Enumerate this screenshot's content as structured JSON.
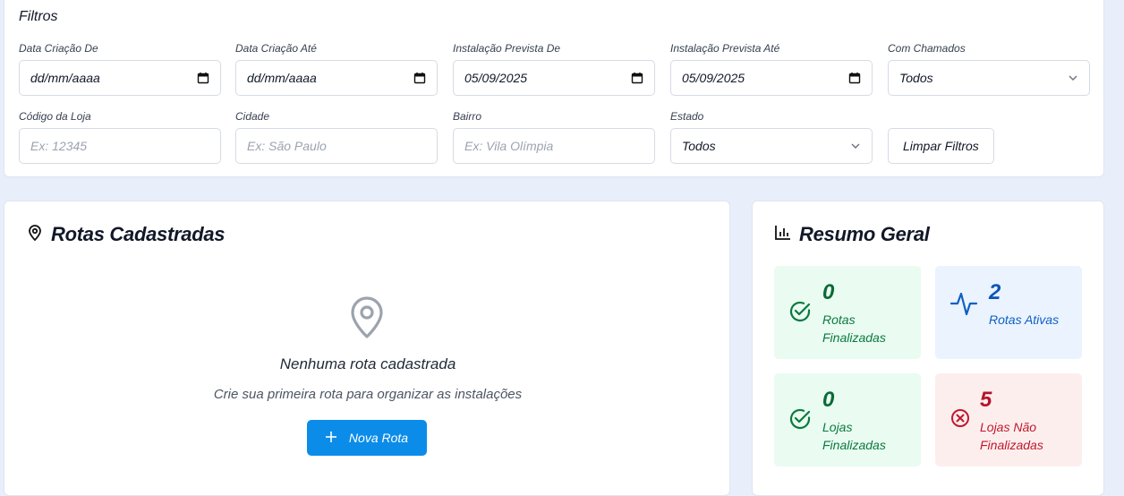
{
  "filters": {
    "title": "Filtros",
    "fields": [
      {
        "label": "Data Criação De",
        "value": "dd/mm/aaaa",
        "icon": "calendar-icon"
      },
      {
        "label": "Data Criação Até",
        "value": "dd/mm/aaaa",
        "icon": "calendar-icon"
      },
      {
        "label": "Instalação Prevista De",
        "value": "05/09/2025",
        "icon": "calendar-icon"
      },
      {
        "label": "Instalação Prevista Até",
        "value": "05/09/2025",
        "icon": "calendar-icon"
      },
      {
        "label": "Com Chamados",
        "value": "Todos",
        "icon": "chevron-down-icon"
      },
      {
        "label": "Código da Loja",
        "placeholder": "Ex: 12345"
      },
      {
        "label": "Cidade",
        "placeholder": "Ex: São Paulo"
      },
      {
        "label": "Bairro",
        "placeholder": "Ex: Vila Olímpia"
      },
      {
        "label": "Estado",
        "value": "Todos",
        "icon": "chevron-down-icon"
      }
    ],
    "clear_label": "Limpar Filtros"
  },
  "routes": {
    "title": "Rotas Cadastradas",
    "icon": "map-pin-icon",
    "empty_title": "Nenhuma rota cadastrada",
    "empty_subtitle": "Crie sua primeira rota para organizar as instalações",
    "new_route_label": "Nova Rota"
  },
  "summary": {
    "title": "Resumo Geral",
    "icon": "bar-chart-icon",
    "stats": [
      {
        "value": "0",
        "label": "Rotas Finalizadas",
        "icon": "check-circle-icon",
        "color": "#0a7a3c"
      },
      {
        "value": "2",
        "label": "Rotas Ativas",
        "icon": "activity-icon",
        "color": "#0f5fc2"
      },
      {
        "value": "0",
        "label": "Lojas Finalizadas",
        "icon": "check-circle-icon",
        "color": "#0a7a3c"
      },
      {
        "value": "5",
        "label": "Lojas Não Finalizadas",
        "icon": "x-circle-icon",
        "color": "#c0182c"
      }
    ]
  },
  "colors": {
    "primary": "#0b8ce9",
    "background": "#e8eefa"
  }
}
